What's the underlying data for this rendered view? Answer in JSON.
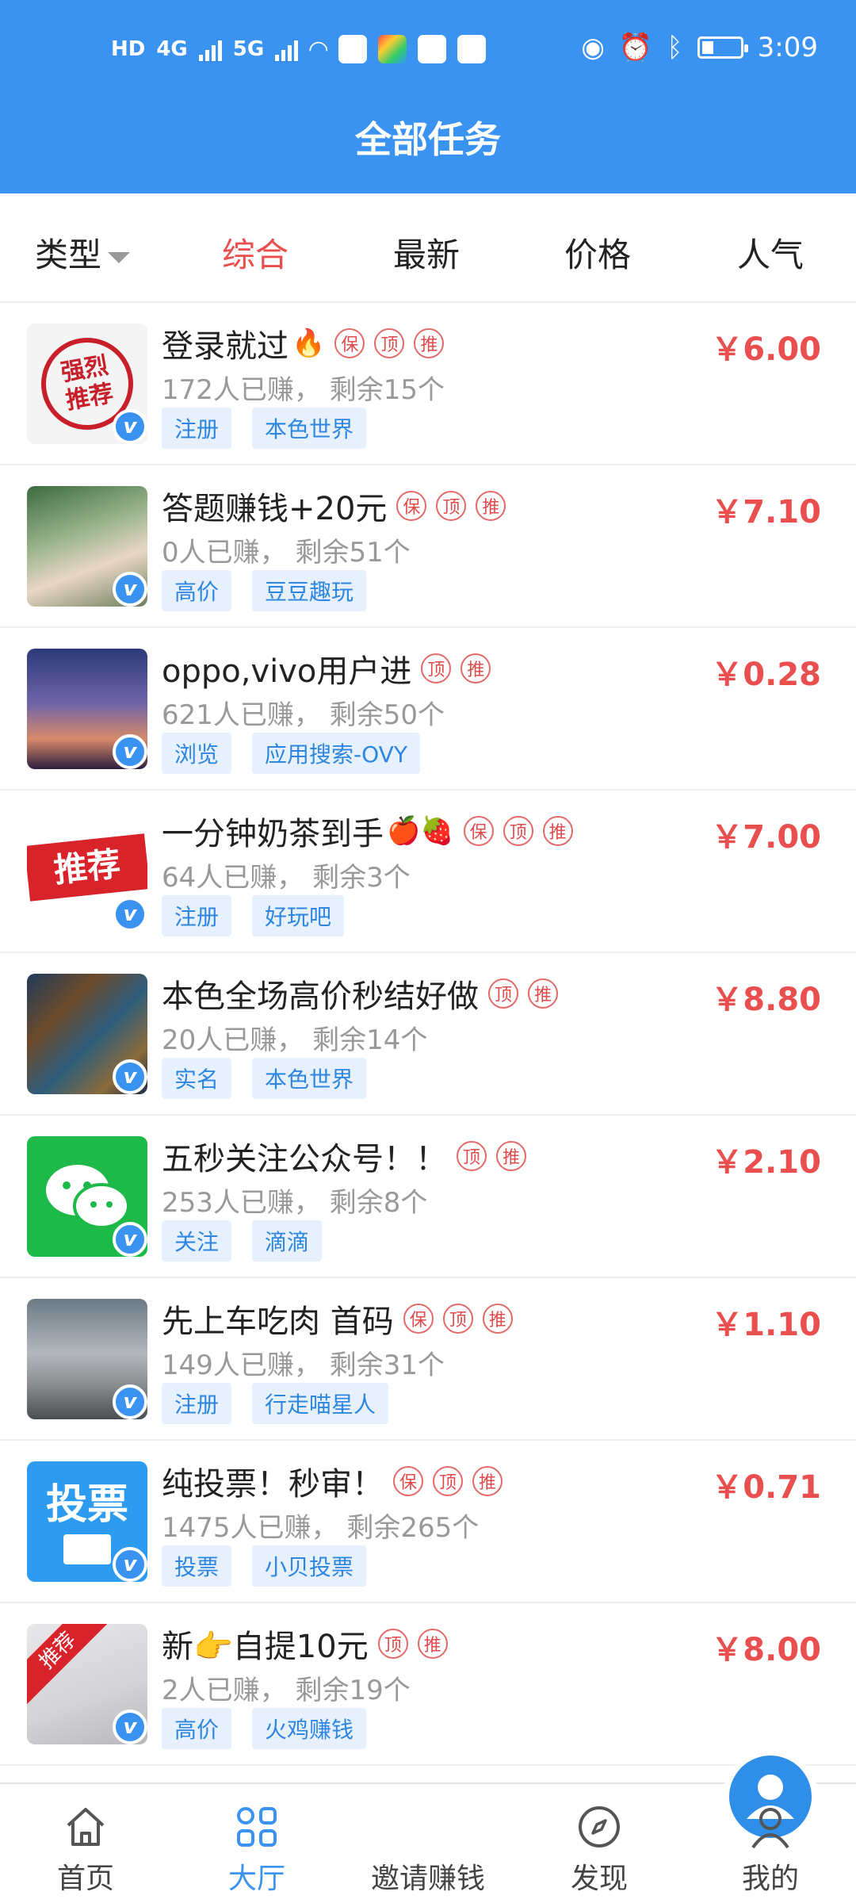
{
  "status_bar": {
    "left_text": "HD",
    "network_a": "4G",
    "network_b": "5G",
    "time": "3:09"
  },
  "header": {
    "title": "全部任务"
  },
  "tabs": [
    {
      "label": "类型",
      "active": false
    },
    {
      "label": "综合",
      "active": true
    },
    {
      "label": "最新",
      "active": false
    },
    {
      "label": "价格",
      "active": false
    },
    {
      "label": "人气",
      "active": false
    }
  ],
  "tasks": [
    {
      "title": "登录就过",
      "emoji": "🔥",
      "tags": [
        "保",
        "顶",
        "推"
      ],
      "earned": "172人已赚，",
      "remaining": "剩余15个",
      "pill1": "注册",
      "pill2": "本色世界",
      "price": "￥6.00",
      "thumb_text_1": "强烈",
      "thumb_text_2": "推荐"
    },
    {
      "title": "答题赚钱+20元",
      "emoji": "",
      "tags": [
        "保",
        "顶",
        "推"
      ],
      "earned": "0人已赚，",
      "remaining": "剩余51个",
      "pill1": "高价",
      "pill2": "豆豆趣玩",
      "price": "￥7.10"
    },
    {
      "title": "oppo,vivo用户进",
      "emoji": "",
      "tags": [
        "顶",
        "推"
      ],
      "earned": "621人已赚，",
      "remaining": "剩余50个",
      "pill1": "浏览",
      "pill2": "应用搜索-OVY",
      "price": "￥0.28"
    },
    {
      "title": "一分钟奶茶到手",
      "emoji": "🍎🍓",
      "tags": [
        "保",
        "顶",
        "推"
      ],
      "earned": "64人已赚，",
      "remaining": "剩余3个",
      "pill1": "注册",
      "pill2": "好玩吧",
      "price": "￥7.00",
      "thumb_text_1": "推荐"
    },
    {
      "title": "本色全场高价秒结好做",
      "emoji": "",
      "tags": [
        "顶",
        "推"
      ],
      "earned": "20人已赚，",
      "remaining": "剩余14个",
      "pill1": "实名",
      "pill2": "本色世界",
      "price": "￥8.80"
    },
    {
      "title": "五秒关注公众号！！",
      "emoji": "",
      "tags": [
        "顶",
        "推"
      ],
      "earned": "253人已赚，",
      "remaining": "剩余8个",
      "pill1": "关注",
      "pill2": "滴滴",
      "price": "￥2.10"
    },
    {
      "title": "先上车吃肉 首码",
      "emoji": "",
      "tags": [
        "保",
        "顶",
        "推"
      ],
      "earned": "149人已赚，",
      "remaining": "剩余31个",
      "pill1": "注册",
      "pill2": "行走喵星人",
      "price": "￥1.10"
    },
    {
      "title": "纯投票！秒审！",
      "emoji": "",
      "tags": [
        "保",
        "顶",
        "推"
      ],
      "earned": "1475人已赚，",
      "remaining": "剩余265个",
      "pill1": "投票",
      "pill2": "小贝投票",
      "price": "￥0.71",
      "thumb_text_1": "投票"
    },
    {
      "title": "新👉自提10元",
      "emoji": "",
      "tags": [
        "顶",
        "推"
      ],
      "earned": "2人已赚，",
      "remaining": "剩余19个",
      "pill1": "高价",
      "pill2": "火鸡赚钱",
      "price": "￥8.00",
      "thumb_text_1": "推荐"
    }
  ],
  "bottom_nav": [
    {
      "label": "首页",
      "icon": "home-icon",
      "active": false
    },
    {
      "label": "大厅",
      "icon": "grid-icon",
      "active": true
    },
    {
      "label": "邀请赚钱",
      "icon": "invite-user-icon",
      "active": false
    },
    {
      "label": "发现",
      "icon": "compass-icon",
      "active": false
    },
    {
      "label": "我的",
      "icon": "user-icon",
      "active": false
    }
  ],
  "colors": {
    "primary": "#3a93f0",
    "price_red": "#ea4f4f",
    "pill_bg": "#e6f1fd"
  }
}
